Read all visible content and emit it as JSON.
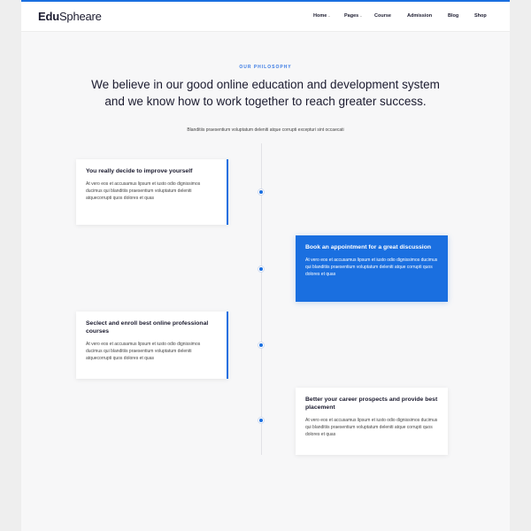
{
  "brand": {
    "logo_bold": "Edu",
    "logo_regular": "Spheare",
    "accent": "#1a6fe0"
  },
  "nav": {
    "items": [
      {
        "label": "Home",
        "has_dropdown": true
      },
      {
        "label": "Pages",
        "has_dropdown": true
      },
      {
        "label": "Course",
        "has_dropdown": false
      },
      {
        "label": "Admission",
        "has_dropdown": false
      },
      {
        "label": "Blog",
        "has_dropdown": false
      },
      {
        "label": "Shop",
        "has_dropdown": false
      }
    ],
    "caret": "⌄"
  },
  "section": {
    "eyebrow": "OUR PHILOSOPHY",
    "headline": "We believe in our good online education and development system and we know how to work together to reach greater success.",
    "subline": "Blanditiis praesentium voluptatum deleniti atque corrupti excepturi sint occaecati"
  },
  "timeline": [
    {
      "side": "left",
      "title": "You really decide to improve yourself",
      "body": "At vero eos et accusamus lipsum et iusto odio dignissimos ducimus qui blanditiis praesentium voluptatum deleniti atquecorrupti quos dolores et quas",
      "active": false
    },
    {
      "side": "right",
      "title": "Book an appointment for a great discussion",
      "body": "At vero eos et accusamus lipsum et iusto odio dignissimos ducimus qui blanditiis praesentium voluptatum deleniti atque corrupti quos dolores et quas",
      "active": true
    },
    {
      "side": "left",
      "title": "Seclect and enroll best online professional courses",
      "body": "At vero eos et accusamus lipsum et iusto odio dignissimos ducimus qui blanditiis praesentium voluptatum deleniti atquecorrupti quos dolores et quas",
      "active": false
    },
    {
      "side": "right",
      "title": "Better your career prospects and provide best placement",
      "body": "At vero eos et accusamus lipsum et iusto odio dignissimos ducimus qui blanditiis praesentium voluptatum deleniti atque corrupti quos dolores et quas",
      "active": false
    }
  ]
}
